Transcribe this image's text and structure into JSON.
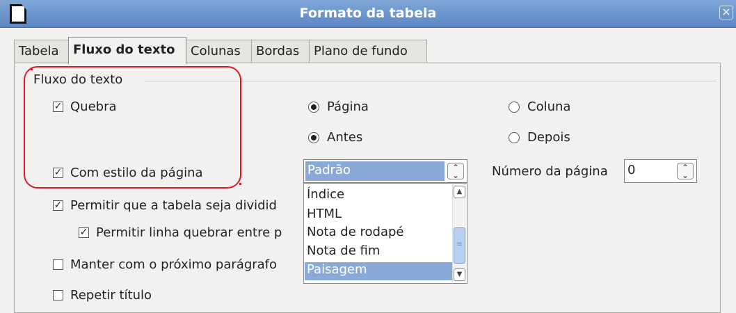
{
  "window": {
    "title": "Formato da tabela",
    "close_glyph": "✕"
  },
  "tabs": [
    {
      "label": "Tabela"
    },
    {
      "label": "Fluxo do texto",
      "active": true
    },
    {
      "label": "Colunas"
    },
    {
      "label": "Bordas"
    },
    {
      "label": "Plano de fundo"
    }
  ],
  "section": {
    "title": "Fluxo do texto"
  },
  "options": {
    "quebra": {
      "label": "Quebra",
      "checked": true
    },
    "pagina": {
      "label": "Página",
      "selected": true
    },
    "coluna": {
      "label": "Coluna",
      "selected": false
    },
    "antes": {
      "label": "Antes",
      "selected": true
    },
    "depois": {
      "label": "Depois",
      "selected": false
    },
    "com_estilo": {
      "label": "Com estilo da página",
      "checked": true
    },
    "page_style": {
      "value": "Padrão"
    },
    "page_number_label": "Número da página",
    "page_number": {
      "value": "0"
    },
    "permitir_tabela": {
      "label": "Permitir que a tabela seja dividid",
      "checked": true
    },
    "permitir_linha": {
      "label": "Permitir linha quebrar entre p",
      "checked": true
    },
    "manter": {
      "label": "Manter com o próximo parágrafo",
      "checked": false
    },
    "repetir": {
      "label": "Repetir título",
      "checked": false
    }
  },
  "dropdown_items": [
    "Índice",
    "HTML",
    "Nota de rodapé",
    "Nota de fim",
    "Paisagem"
  ],
  "dropdown_selected": "Paisagem",
  "icons": {
    "check": "✓",
    "spin_up": "⌃",
    "spin_down": "⌄",
    "scroll_up": "▲",
    "scroll_down": "▼",
    "grip": "≡"
  },
  "colors": {
    "highlight": "#e2182a",
    "selection": "#8aa9d6",
    "titlebar": "#6f97cf"
  }
}
